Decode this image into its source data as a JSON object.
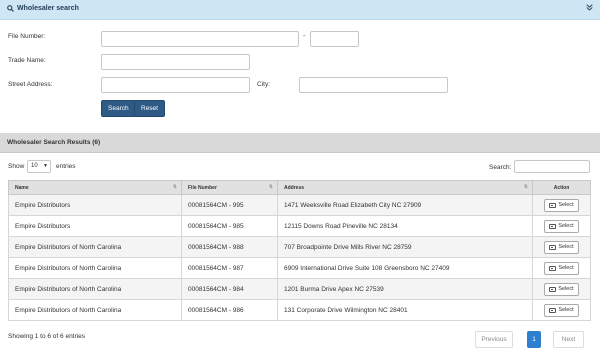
{
  "search_panel": {
    "title": "Wholesaler search",
    "collapse_icon": "double-chevron-down-icon",
    "file_number_label": "File Number:",
    "file_number_sep": "-",
    "trade_name_label": "Trade Name:",
    "street_address_label": "Street Address:",
    "city_label": "City:",
    "search_button": "Search",
    "reset_button": "Reset"
  },
  "results": {
    "title": "Wholesaler Search Results (6)",
    "show_label": "Show",
    "page_size": "10",
    "entries_label": "entries",
    "search_label": "Search:",
    "columns": [
      "Name",
      "File Number",
      "Address",
      "Action"
    ],
    "rows": [
      {
        "name": "Empire Distributors",
        "file_number": "00081564CM - 995",
        "address": "1471 Weeksville Road Elizabeth City NC 27909",
        "action": "Select"
      },
      {
        "name": "Empire Distributors",
        "file_number": "00081564CM - 985",
        "address": "12115 Downs Road Pineville NC 28134",
        "action": "Select"
      },
      {
        "name": "Empire Distributors of North Carolina",
        "file_number": "00081564CM - 988",
        "address": "707 Broadpointe Drive Mills River NC 28759",
        "action": "Select"
      },
      {
        "name": "Empire Distributors of North Carolina",
        "file_number": "00081564CM - 987",
        "address": "6909 International Drive Suite 108 Greensboro NC 27409",
        "action": "Select"
      },
      {
        "name": "Empire Distributors of North Carolina",
        "file_number": "00081564CM - 984",
        "address": "1201 Burma Drive Apex NC 27539",
        "action": "Select"
      },
      {
        "name": "Empire Distributors of North Carolina",
        "file_number": "00081564CM - 986",
        "address": "131 Corporate Drive Wilmington NC 28401",
        "action": "Select"
      }
    ],
    "info": "Showing 1 to 6 of 6 entries",
    "pagination": {
      "previous": "Previous",
      "current": "1",
      "next": "Next"
    }
  },
  "colors": {
    "header_bg": "#cfe7f5",
    "primary_button": "#2d5b86",
    "active_page": "#2f7fd0",
    "results_header_bg": "#d9d9d9"
  }
}
